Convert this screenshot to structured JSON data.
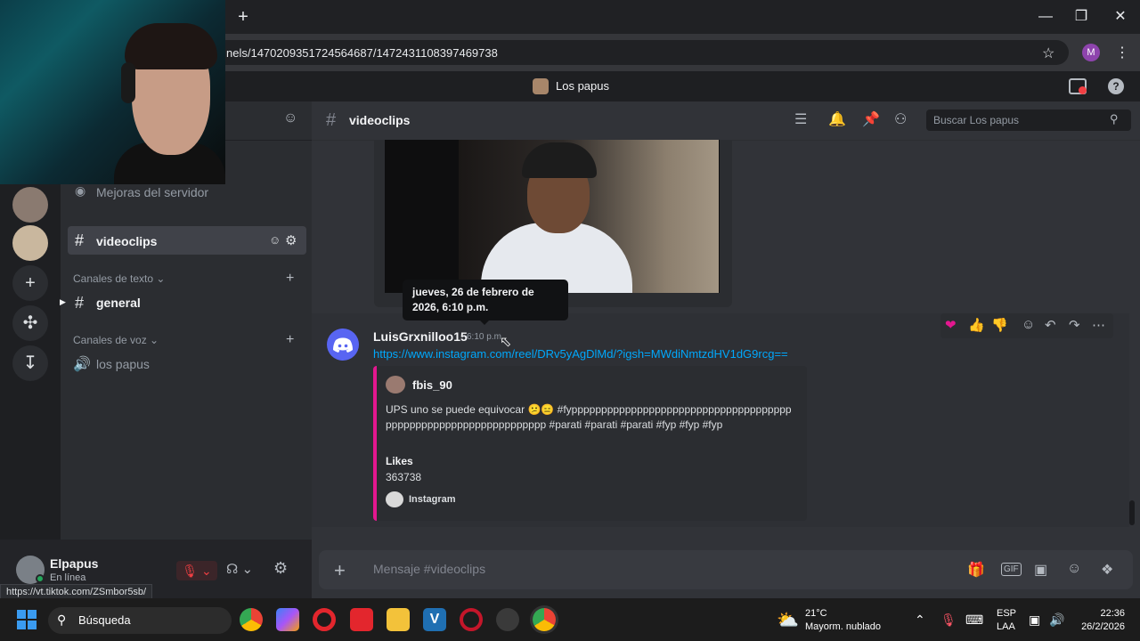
{
  "browser": {
    "url": "nels/1470209351724564687/1472431108397469738",
    "profile_initial": "M",
    "status_url": "https://vt.tiktok.com/ZSmbor5sb/"
  },
  "discord": {
    "server_name": "Los papus",
    "sidebar": {
      "boost_label": "Mejoras del servidor",
      "active_channel": "videoclips",
      "text_category": "Canales de texto",
      "text_channels": [
        "general"
      ],
      "voice_category": "Canales de voz",
      "voice_channels": [
        "los papus"
      ]
    },
    "user": {
      "name": "Elpapus",
      "status": "En línea"
    },
    "header": {
      "channel": "videoclips",
      "search_placeholder": "Buscar Los papus"
    },
    "tooltip": "jueves, 26 de febrero de 2026, 6:10 p.m.",
    "message": {
      "author": "LuisGrxnilloo15",
      "time": "6:10 p.m.",
      "link": "https://www.instagram.com/reel/DRv5yAgDlMd/?igsh=MWdiNmtzdHV1dG9rcg==",
      "embed": {
        "author": "fbis_90",
        "description": "UPS uno se puede equivocar 😕😑 #fypppppppppppppppppppppppppppppppppppppppppppppppppppppppppppppppp #parati #parati #parati #fyp #fyp #fyp",
        "field_name": "Likes",
        "field_value": "363738",
        "footer": "Instagram",
        "color": "#e3178f"
      }
    },
    "composer_placeholder": "Mensaje #videoclips"
  },
  "taskbar": {
    "search_label": "Búsqueda",
    "temperature": "21°C",
    "weather": "Mayorm. nublado",
    "lang_1": "ESP",
    "lang_2": "LAA",
    "time": "22:36",
    "date": "26/2/2026"
  },
  "colors": {
    "accent": "#5865f2",
    "link": "#00a8fc",
    "online": "#23a55a"
  }
}
